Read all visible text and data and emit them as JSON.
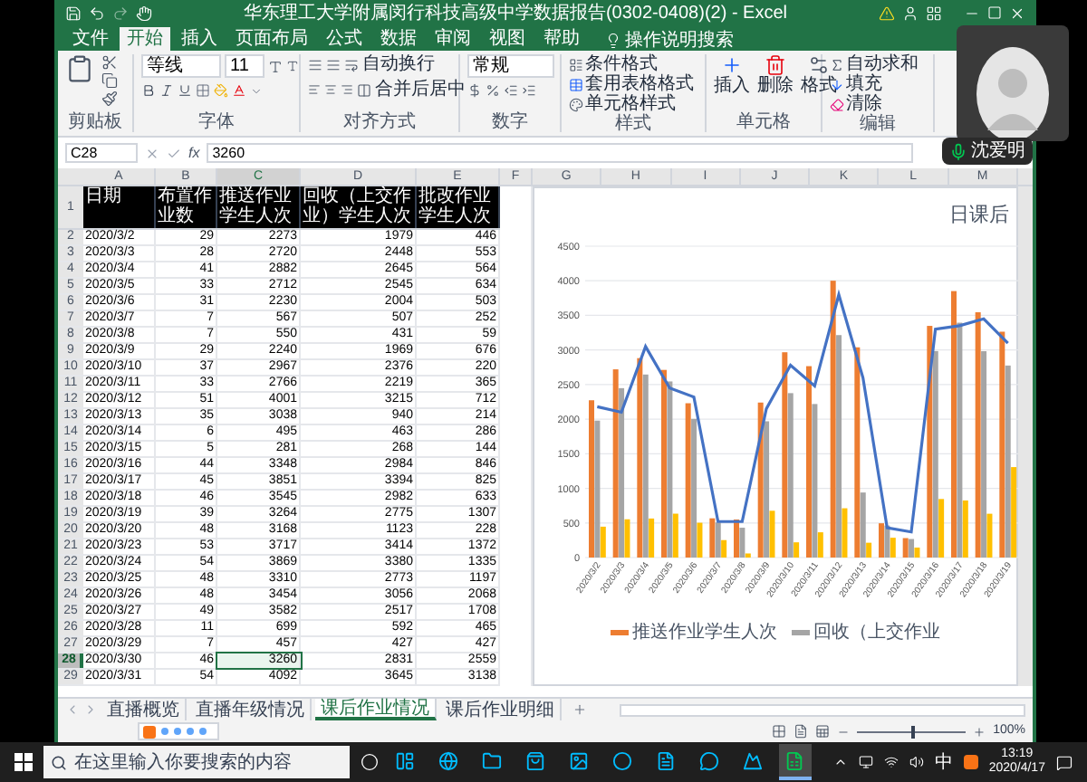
{
  "window": {
    "title": "华东理工大学附属闵行科技高级中学数据报告(0302-0408)(2) - Excel"
  },
  "ribbon_tabs": [
    {
      "label": "文件",
      "selected": false
    },
    {
      "label": "开始",
      "selected": true
    },
    {
      "label": "插入",
      "selected": false
    },
    {
      "label": "页面布局",
      "selected": false
    },
    {
      "label": "公式",
      "selected": false
    },
    {
      "label": "数据",
      "selected": false
    },
    {
      "label": "审阅",
      "selected": false
    },
    {
      "label": "视图",
      "selected": false
    },
    {
      "label": "帮助",
      "selected": false
    }
  ],
  "tell_me": "操作说明搜索",
  "ribbon": {
    "groups": [
      "剪贴板",
      "字体",
      "对齐方式",
      "数字",
      "样式",
      "单元格",
      "编辑"
    ],
    "font_name": "等线",
    "font_size": "11",
    "wrap_text": "自动换行",
    "merge_center": "合并后居中",
    "number_format": "常规",
    "conditional_format": "条件格式",
    "format_as_table": "套用表格格式",
    "cell_styles": "单元格样式",
    "insert": "插入",
    "delete": "删除",
    "format": "格式",
    "autosum": "自动求和",
    "fill": "填充",
    "clear": "清除"
  },
  "formula_bar": {
    "name_box": "C28",
    "function_label": "fx",
    "value": "3260"
  },
  "columns": [
    "A",
    "B",
    "C",
    "D",
    "E",
    "F",
    "G",
    "H",
    "I",
    "J",
    "K",
    "L",
    "M"
  ],
  "header_row": {
    "number": "1",
    "cells": [
      "日期",
      "布置作业数",
      "推送作业学生人次",
      "回收（上交作业）学生人次",
      "批改作业学生人次"
    ]
  },
  "rows": [
    {
      "number": "2",
      "selected": false,
      "cells": [
        "2020/3/2",
        "29",
        "2273",
        "1979",
        "446"
      ]
    },
    {
      "number": "3",
      "selected": false,
      "cells": [
        "2020/3/3",
        "28",
        "2720",
        "2448",
        "553"
      ]
    },
    {
      "number": "4",
      "selected": false,
      "cells": [
        "2020/3/4",
        "41",
        "2882",
        "2645",
        "564"
      ]
    },
    {
      "number": "5",
      "selected": false,
      "cells": [
        "2020/3/5",
        "33",
        "2712",
        "2545",
        "634"
      ]
    },
    {
      "number": "6",
      "selected": false,
      "cells": [
        "2020/3/6",
        "31",
        "2230",
        "2004",
        "503"
      ]
    },
    {
      "number": "7",
      "selected": false,
      "cells": [
        "2020/3/7",
        "7",
        "567",
        "507",
        "252"
      ]
    },
    {
      "number": "8",
      "selected": false,
      "cells": [
        "2020/3/8",
        "7",
        "550",
        "431",
        "59"
      ]
    },
    {
      "number": "9",
      "selected": false,
      "cells": [
        "2020/3/9",
        "29",
        "2240",
        "1969",
        "676"
      ]
    },
    {
      "number": "10",
      "selected": false,
      "cells": [
        "2020/3/10",
        "37",
        "2967",
        "2376",
        "220"
      ]
    },
    {
      "number": "11",
      "selected": false,
      "cells": [
        "2020/3/11",
        "33",
        "2766",
        "2219",
        "365"
      ]
    },
    {
      "number": "12",
      "selected": false,
      "cells": [
        "2020/3/12",
        "51",
        "4001",
        "3215",
        "712"
      ]
    },
    {
      "number": "13",
      "selected": false,
      "cells": [
        "2020/3/13",
        "35",
        "3038",
        "940",
        "214"
      ]
    },
    {
      "number": "14",
      "selected": false,
      "cells": [
        "2020/3/14",
        "6",
        "495",
        "463",
        "286"
      ]
    },
    {
      "number": "15",
      "selected": false,
      "cells": [
        "2020/3/15",
        "5",
        "281",
        "268",
        "144"
      ]
    },
    {
      "number": "16",
      "selected": false,
      "cells": [
        "2020/3/16",
        "44",
        "3348",
        "2984",
        "846"
      ]
    },
    {
      "number": "17",
      "selected": false,
      "cells": [
        "2020/3/17",
        "45",
        "3851",
        "3394",
        "825"
      ]
    },
    {
      "number": "18",
      "selected": false,
      "cells": [
        "2020/3/18",
        "46",
        "3545",
        "2982",
        "633"
      ]
    },
    {
      "number": "19",
      "selected": false,
      "cells": [
        "2020/3/19",
        "39",
        "3264",
        "2775",
        "1307"
      ]
    },
    {
      "number": "20",
      "selected": false,
      "cells": [
        "2020/3/20",
        "48",
        "3168",
        "1123",
        "228"
      ]
    },
    {
      "number": "21",
      "selected": false,
      "cells": [
        "2020/3/23",
        "53",
        "3717",
        "3414",
        "1372"
      ]
    },
    {
      "number": "22",
      "selected": false,
      "cells": [
        "2020/3/24",
        "54",
        "3869",
        "3380",
        "1335"
      ]
    },
    {
      "number": "23",
      "selected": false,
      "cells": [
        "2020/3/25",
        "48",
        "3310",
        "2773",
        "1197"
      ]
    },
    {
      "number": "24",
      "selected": false,
      "cells": [
        "2020/3/26",
        "48",
        "3454",
        "3056",
        "2068"
      ]
    },
    {
      "number": "25",
      "selected": false,
      "cells": [
        "2020/3/27",
        "49",
        "3582",
        "2517",
        "1708"
      ]
    },
    {
      "number": "26",
      "selected": false,
      "cells": [
        "2020/3/28",
        "11",
        "699",
        "592",
        "465"
      ]
    },
    {
      "number": "27",
      "selected": false,
      "cells": [
        "2020/3/29",
        "7",
        "457",
        "427",
        "427"
      ]
    },
    {
      "number": "28",
      "selected": true,
      "cells": [
        "2020/3/30",
        "46",
        "3260",
        "2831",
        "2559"
      ]
    },
    {
      "number": "29",
      "selected": false,
      "cells": [
        "2020/3/31",
        "54",
        "4092",
        "3645",
        "3138"
      ]
    }
  ],
  "chart": {
    "chart_data": {
      "type": "bar",
      "title": "日课后",
      "grid": true,
      "categories": [
        "2020/3/2",
        "2020/3/3",
        "2020/3/4",
        "2020/3/5",
        "2020/3/6",
        "2020/3/7",
        "2020/3/8",
        "2020/3/9",
        "2020/3/10",
        "2020/3/11",
        "2020/3/12",
        "2020/3/13",
        "2020/3/14",
        "2020/3/15",
        "2020/3/16",
        "2020/3/17",
        "2020/3/18",
        "2020/3/19"
      ],
      "ylim": [
        0,
        4500
      ],
      "stacked": false,
      "yticks": [
        0,
        500,
        1000,
        1500,
        2000,
        2500,
        3000,
        3500,
        4000,
        4500
      ],
      "series": [
        {
          "name": "推送作业学生人次",
          "color": "#ed7d31",
          "type": "bar",
          "values": [
            2273,
            2720,
            2882,
            2712,
            2230,
            567,
            550,
            2240,
            2967,
            2766,
            4001,
            3038,
            495,
            281,
            3348,
            3851,
            3545,
            3264
          ]
        },
        {
          "name": "回收（上交作业",
          "color": "#a5a5a5",
          "type": "bar",
          "values": [
            1979,
            2448,
            2645,
            2545,
            2004,
            507,
            431,
            1969,
            2376,
            2219,
            3215,
            940,
            463,
            268,
            2984,
            3394,
            2982,
            2775
          ]
        },
        {
          "color": "#ffc000",
          "type": "bar",
          "values": [
            446,
            553,
            564,
            634,
            503,
            252,
            59,
            676,
            220,
            365,
            712,
            214,
            286,
            144,
            846,
            825,
            633,
            1307
          ]
        },
        {
          "color": "#4472c4",
          "type": "line",
          "values": [
            2180,
            2100,
            3050,
            2450,
            2320,
            520,
            520,
            2150,
            2780,
            2480,
            3800,
            2600,
            430,
            370,
            3300,
            3350,
            3450,
            3100
          ]
        }
      ]
    }
  },
  "sheet_tabs": [
    {
      "label": "直播概览",
      "selected": false
    },
    {
      "label": "直播年级情况",
      "selected": false
    },
    {
      "label": "课后作业情况",
      "selected": true
    },
    {
      "label": "课后作业明细",
      "selected": false
    }
  ],
  "status_bar": {
    "zoom": {
      "level": 0.5,
      "reading": "100%"
    }
  },
  "taskbar": {
    "search_placeholder": "在这里输入你要搜索的内容",
    "apps": [
      {
        "selected": false
      },
      {
        "selected": false
      },
      {
        "selected": false
      },
      {
        "selected": false
      },
      {
        "selected": false
      },
      {
        "selected": false
      },
      {
        "selected": false
      },
      {
        "selected": false
      },
      {
        "selected": false
      },
      {
        "selected": true
      }
    ],
    "ime": "中",
    "time": "13:19",
    "date": "2020/4/17"
  },
  "participant": {
    "name": "沈爱明"
  }
}
